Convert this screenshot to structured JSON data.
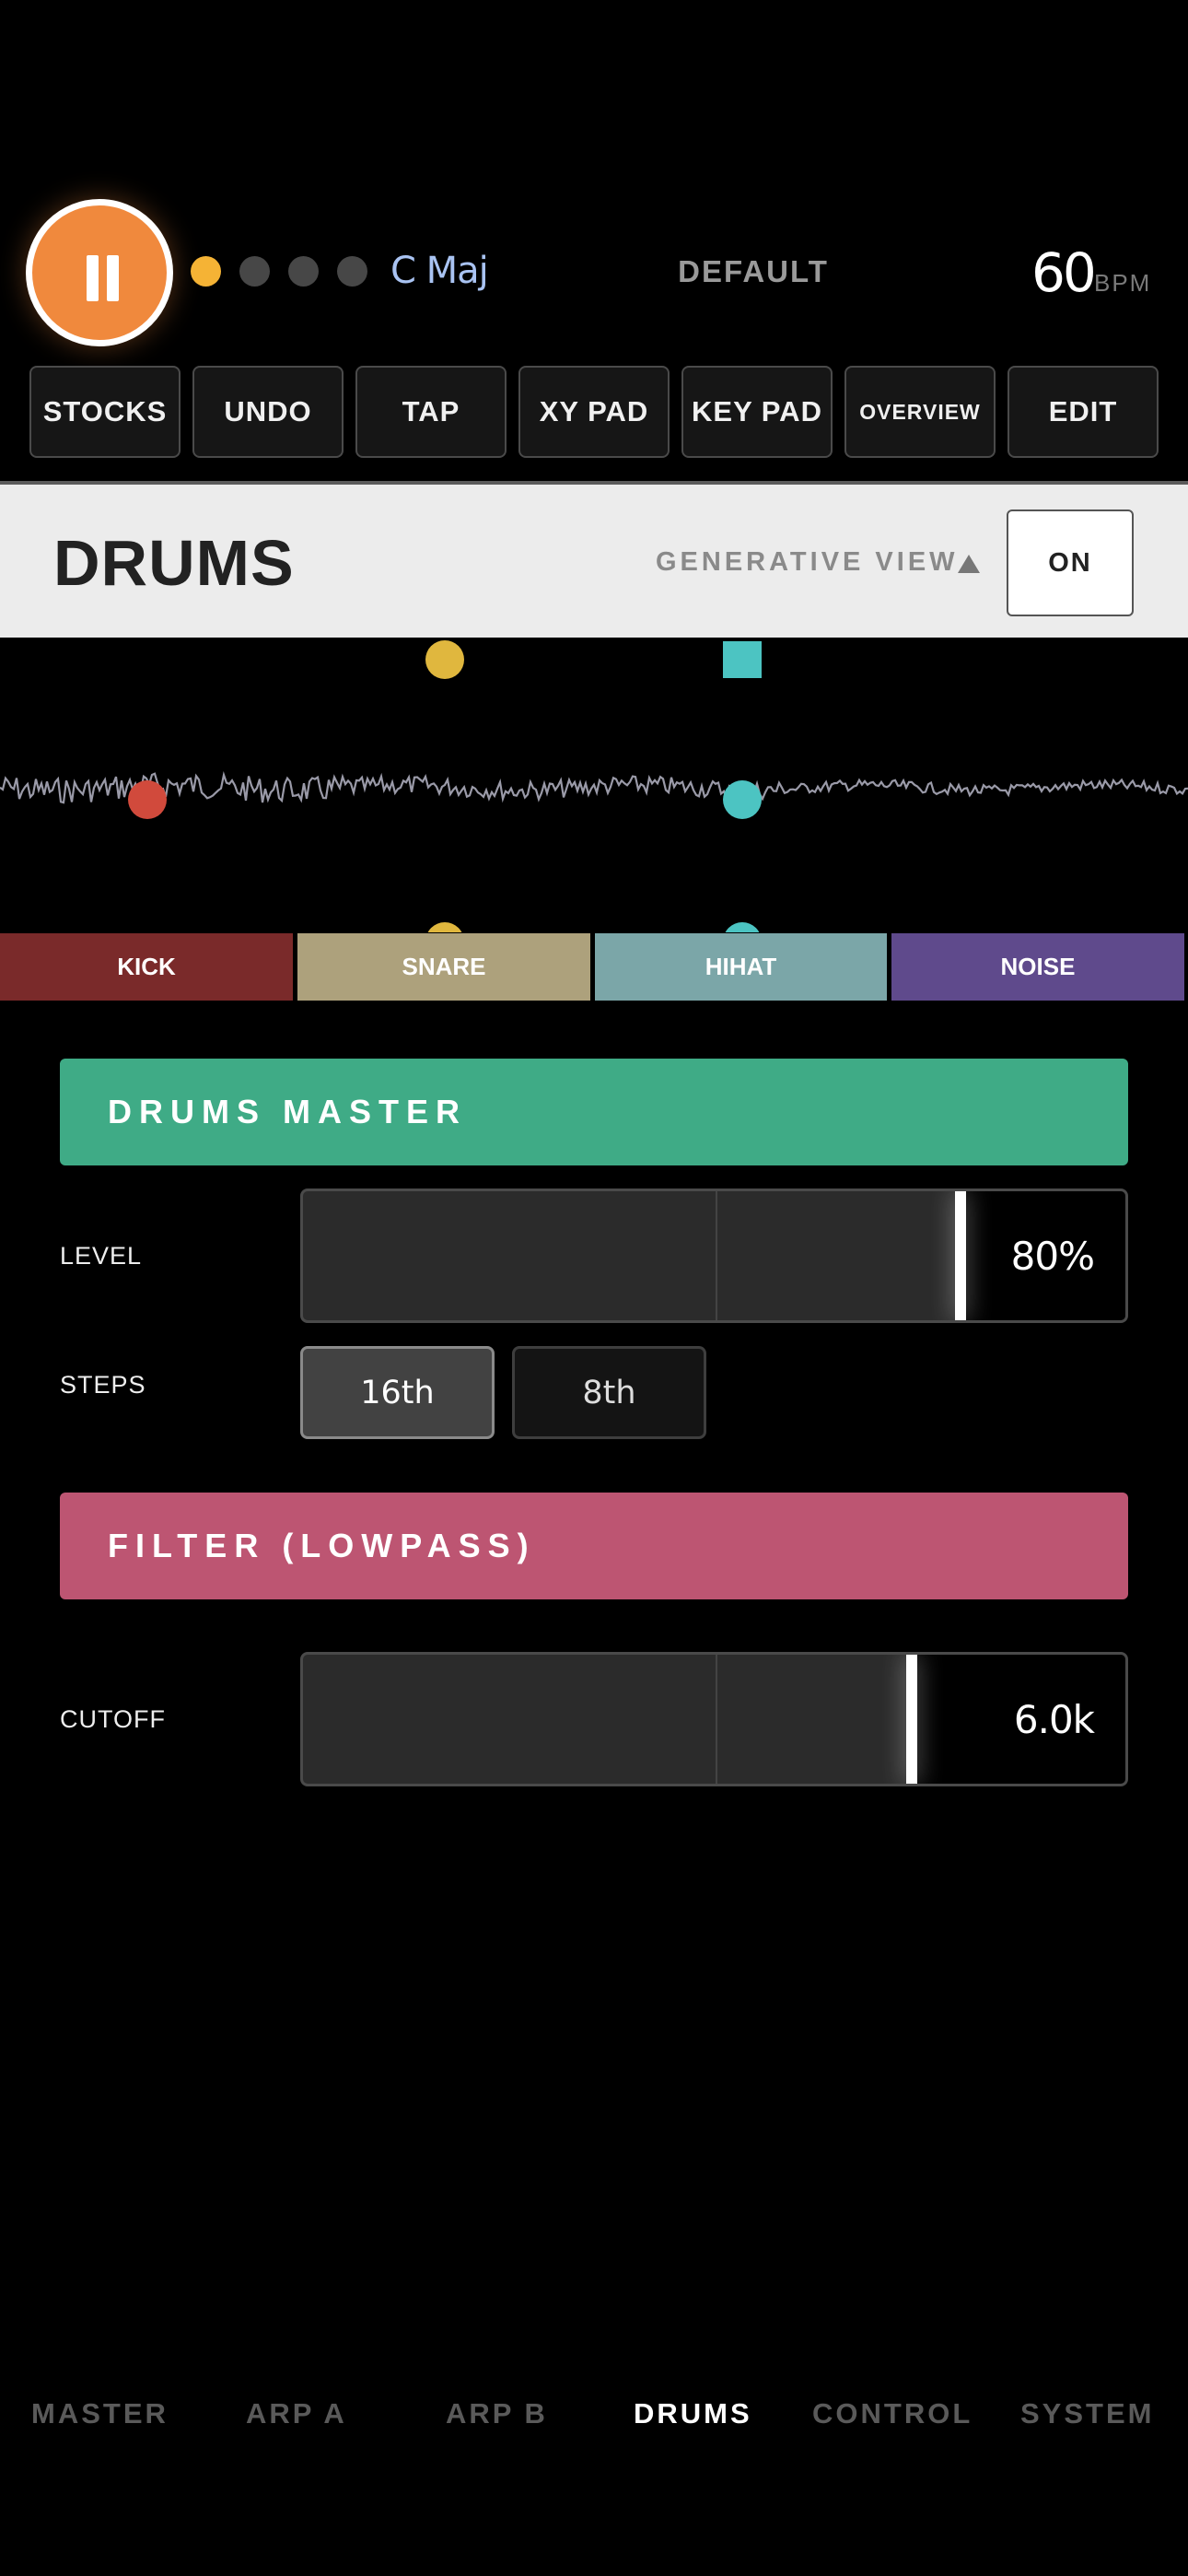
{
  "transport": {
    "state": "playing",
    "play_pause_icon": "pause-icon",
    "accent_color": "#f0893d",
    "step_dots": [
      true,
      false,
      false,
      false
    ],
    "key": "C Maj",
    "preset": "DEFAULT",
    "bpm": "60",
    "bpm_unit": "BPM"
  },
  "toolbar": [
    "STOCKS",
    "UNDO",
    "TAP",
    "XY PAD",
    "KEY PAD",
    "OVERVIEW",
    "EDIT"
  ],
  "header": {
    "title": "DRUMS",
    "generative_view_label": "GENERATIVE VIEW",
    "generative_view_icon": "triangle-up-icon",
    "on_button": "ON"
  },
  "tracks": [
    {
      "label": "KICK",
      "color": "#7a2a2a"
    },
    {
      "label": "SNARE",
      "color": "#ada17c"
    },
    {
      "label": "HIHAT",
      "color": "#7ba6a8"
    },
    {
      "label": "NOISE",
      "color": "#5f4a8c"
    }
  ],
  "master": {
    "title": "DRUMS MASTER",
    "color": "#3fab86",
    "level_label": "LEVEL",
    "level_value": "80%",
    "level_fraction": 0.8,
    "steps_label": "STEPS",
    "steps_options": [
      "16th",
      "8th"
    ],
    "steps_selected": "16th"
  },
  "filter": {
    "title": "FILTER (LOWPASS)",
    "color": "#bd5572",
    "cutoff_label": "CUTOFF",
    "cutoff_value": "6.0k",
    "cutoff_fraction": 0.74
  },
  "bottom_nav": {
    "items": [
      "MASTER",
      "ARP A",
      "ARP B",
      "DRUMS",
      "CONTROL",
      "SYSTEM"
    ],
    "active": "DRUMS"
  }
}
